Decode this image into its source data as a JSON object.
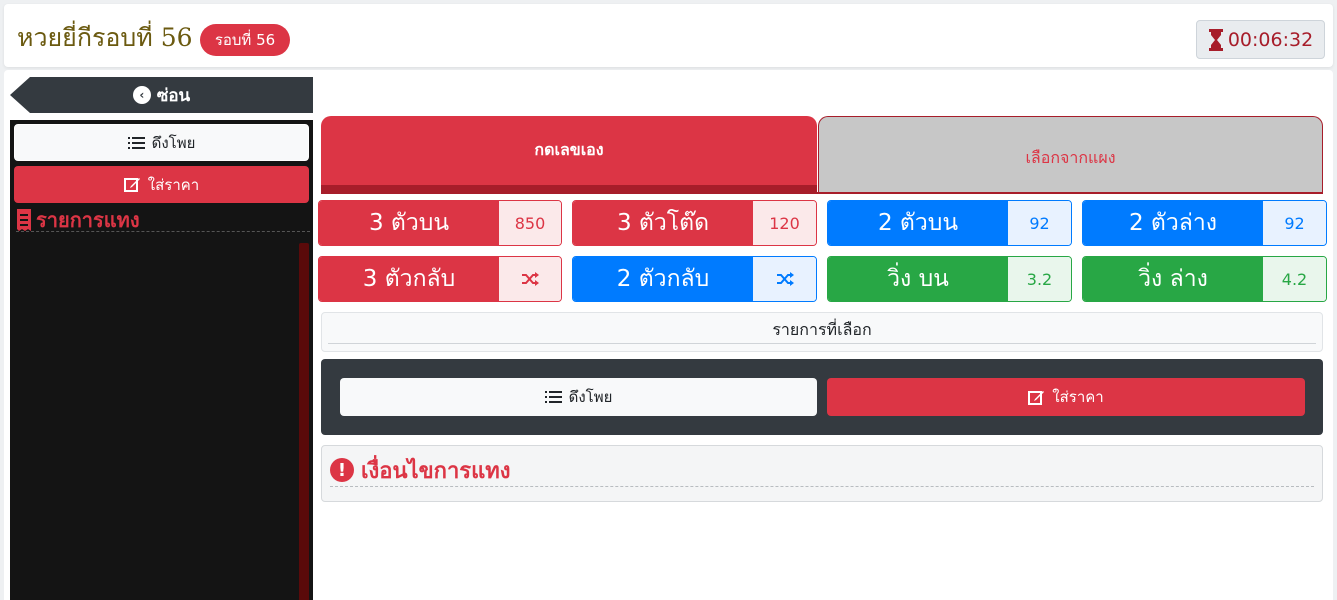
{
  "header": {
    "title": "หวยยี่กีรอบที่ 56",
    "round_badge": "รอบที่ 56",
    "timer": "00:06:32"
  },
  "sidebar": {
    "hide_label": "ซ่อน",
    "pull_bets_label": "ดึงโพย",
    "set_price_label": "ใส่ราคา",
    "bet_list_title": "รายการแทง"
  },
  "tabs": [
    {
      "label": "กดเลขเอง",
      "active": true
    },
    {
      "label": "เลือกจากแผง",
      "active": false
    }
  ],
  "bets": [
    {
      "label": "3 ตัวบน",
      "value": "850",
      "color": "#dc3545"
    },
    {
      "label": "3 ตัวโต๊ด",
      "value": "120",
      "color": "#dc3545"
    },
    {
      "label": "2 ตัวบน",
      "value": "92",
      "color": "#007bff"
    },
    {
      "label": "2 ตัวล่าง",
      "value": "92",
      "color": "#007bff"
    },
    {
      "label": "3 ตัวกลับ",
      "icon": "shuffle-icon",
      "color": "#dc3545"
    },
    {
      "label": "2 ตัวกลับ",
      "icon": "shuffle-icon",
      "color": "#007bff"
    },
    {
      "label": "วิ่ง บน",
      "value": "3.2",
      "color": "#28a745"
    },
    {
      "label": "วิ่ง ล่าง",
      "value": "4.2",
      "color": "#28a745"
    }
  ],
  "selected_list": {
    "title": "รายการที่เลือก"
  },
  "actions": {
    "pull_bets_label": "ดึงโพย",
    "set_price_label": "ใส่ราคา"
  },
  "conditions": {
    "title": "เงื่อนไขการแทง"
  },
  "colors": {
    "danger": "#dc3545",
    "primary": "#007bff",
    "success": "#28a745",
    "dark": "#343a40"
  }
}
